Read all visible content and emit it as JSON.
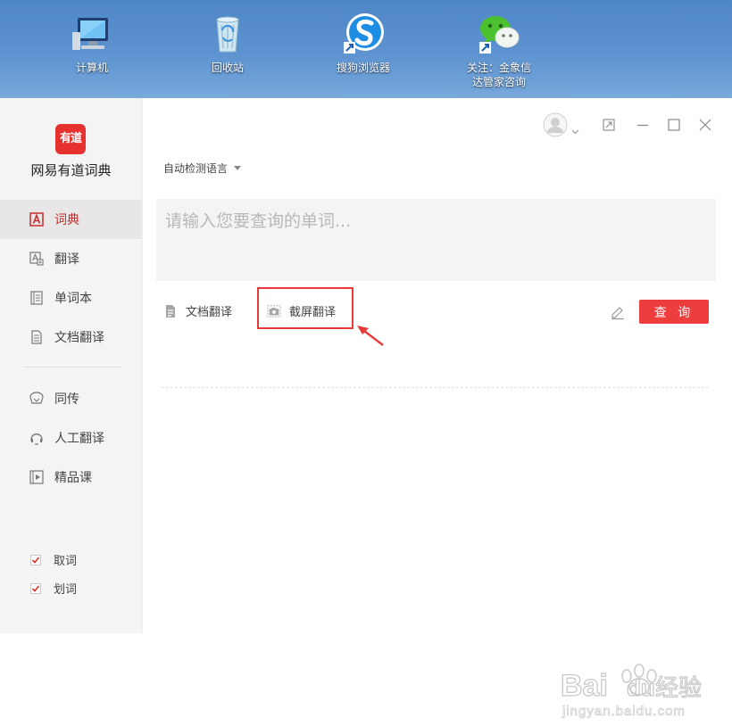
{
  "desktop": {
    "icons": [
      {
        "label": "计算机",
        "icon": "computer-icon"
      },
      {
        "label": "回收站",
        "icon": "recycle-bin-icon"
      },
      {
        "label": "搜狗浏览器",
        "icon": "sogou-browser-icon"
      },
      {
        "label_line1": "关注：金象信",
        "label_line2": "达管家咨询",
        "icon": "wechat-icon"
      }
    ]
  },
  "sidebar": {
    "logo_text": "有道",
    "app_name": "网易有道词典",
    "items": [
      {
        "label": "词典",
        "icon": "dictionary-icon",
        "active": true
      },
      {
        "label": "翻译",
        "icon": "translate-icon"
      },
      {
        "label": "单词本",
        "icon": "wordbook-icon"
      },
      {
        "label": "文档翻译",
        "icon": "document-icon"
      },
      {
        "label": "同传",
        "icon": "simultaneous-icon"
      },
      {
        "label": "人工翻译",
        "icon": "human-translation-icon"
      },
      {
        "label": "精品课",
        "icon": "course-icon"
      }
    ],
    "options": [
      {
        "label": "取词",
        "checked": true
      },
      {
        "label": "划词",
        "checked": true
      }
    ]
  },
  "main": {
    "language_select": "自动检测语言",
    "search": {
      "placeholder": "请输入您要查询的单词...",
      "value": ""
    },
    "tools": {
      "doc_translate": "文档翻译",
      "screenshot_translate": "截屏翻译"
    },
    "query_button": "查 询"
  },
  "watermark": {
    "brand": "Bai",
    "brand2": "du",
    "cn": "经验",
    "url": "jingyan.baidu.com"
  },
  "colors": {
    "accent": "#ee3d3d",
    "desktop_blue": "#5d93d0",
    "sidebar_bg": "#f4f4f4",
    "active_text": "#c62e2e"
  }
}
